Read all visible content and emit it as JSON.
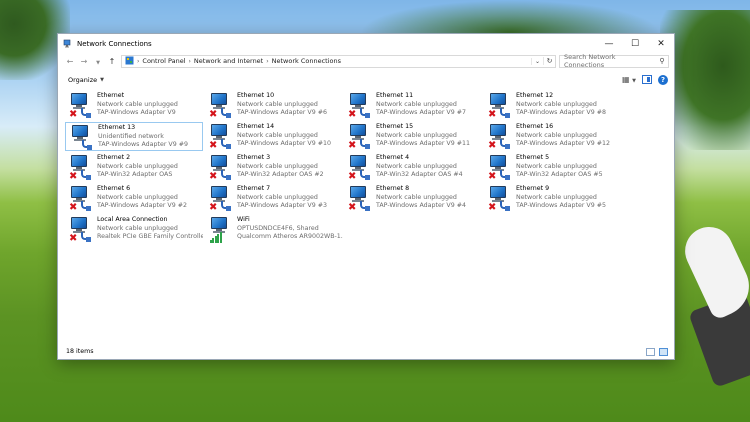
{
  "window": {
    "title": "Network Connections"
  },
  "address": {
    "breadcrumbs": [
      "Control Panel",
      "Network and Internet",
      "Network Connections"
    ],
    "search_placeholder": "Search Network Connections"
  },
  "commandbar": {
    "organize_label": "Organize"
  },
  "items": [
    {
      "name": "Ethernet",
      "status": "Network cable unplugged",
      "device": "TAP-Windows Adapter V9",
      "type": "ethernet",
      "disconnected": true
    },
    {
      "name": "Ethernet 10",
      "status": "Network cable unplugged",
      "device": "TAP-Windows Adapter V9 #6",
      "type": "ethernet",
      "disconnected": true
    },
    {
      "name": "Ethernet 11",
      "status": "Network cable unplugged",
      "device": "TAP-Windows Adapter V9 #7",
      "type": "ethernet",
      "disconnected": true
    },
    {
      "name": "Ethernet 12",
      "status": "Network cable unplugged",
      "device": "TAP-Windows Adapter V9 #8",
      "type": "ethernet",
      "disconnected": true
    },
    {
      "name": "Ethernet 13",
      "status": "Unidentified network",
      "device": "TAP-Windows Adapter V9 #9",
      "type": "ethernet",
      "disconnected": false,
      "selected": true
    },
    {
      "name": "Ethernet 14",
      "status": "Network cable unplugged",
      "device": "TAP-Windows Adapter V9 #10",
      "type": "ethernet",
      "disconnected": true
    },
    {
      "name": "Ethernet 15",
      "status": "Network cable unplugged",
      "device": "TAP-Windows Adapter V9 #11",
      "type": "ethernet",
      "disconnected": true
    },
    {
      "name": "Ethernet 16",
      "status": "Network cable unplugged",
      "device": "TAP-Windows Adapter V9 #12",
      "type": "ethernet",
      "disconnected": true
    },
    {
      "name": "Ethernet 2",
      "status": "Network cable unplugged",
      "device": "TAP-Win32 Adapter OAS",
      "type": "ethernet",
      "disconnected": true
    },
    {
      "name": "Ethernet 3",
      "status": "Network cable unplugged",
      "device": "TAP-Win32 Adapter OAS #2",
      "type": "ethernet",
      "disconnected": true
    },
    {
      "name": "Ethernet 4",
      "status": "Network cable unplugged",
      "device": "TAP-Win32 Adapter OAS #4",
      "type": "ethernet",
      "disconnected": true
    },
    {
      "name": "Ethernet 5",
      "status": "Network cable unplugged",
      "device": "TAP-Win32 Adapter OAS #5",
      "type": "ethernet",
      "disconnected": true
    },
    {
      "name": "Ethernet 6",
      "status": "Network cable unplugged",
      "device": "TAP-Windows Adapter V9 #2",
      "type": "ethernet",
      "disconnected": true
    },
    {
      "name": "Ethernet 7",
      "status": "Network cable unplugged",
      "device": "TAP-Windows Adapter V9 #3",
      "type": "ethernet",
      "disconnected": true
    },
    {
      "name": "Ethernet 8",
      "status": "Network cable unplugged",
      "device": "TAP-Windows Adapter V9 #4",
      "type": "ethernet",
      "disconnected": true
    },
    {
      "name": "Ethernet 9",
      "status": "Network cable unplugged",
      "device": "TAP-Windows Adapter V9 #5",
      "type": "ethernet",
      "disconnected": true
    },
    {
      "name": "Local Area Connection",
      "status": "Network cable unplugged",
      "device": "Realtek PCIe GBE Family Controller",
      "type": "ethernet",
      "disconnected": true
    },
    {
      "name": "WiFi",
      "status": "OPTUSDNDCE4F6, Shared",
      "device": "Qualcomm Atheros AR9002WB-1...",
      "type": "wifi",
      "disconnected": false
    }
  ],
  "status": {
    "count_label": "18 items"
  }
}
